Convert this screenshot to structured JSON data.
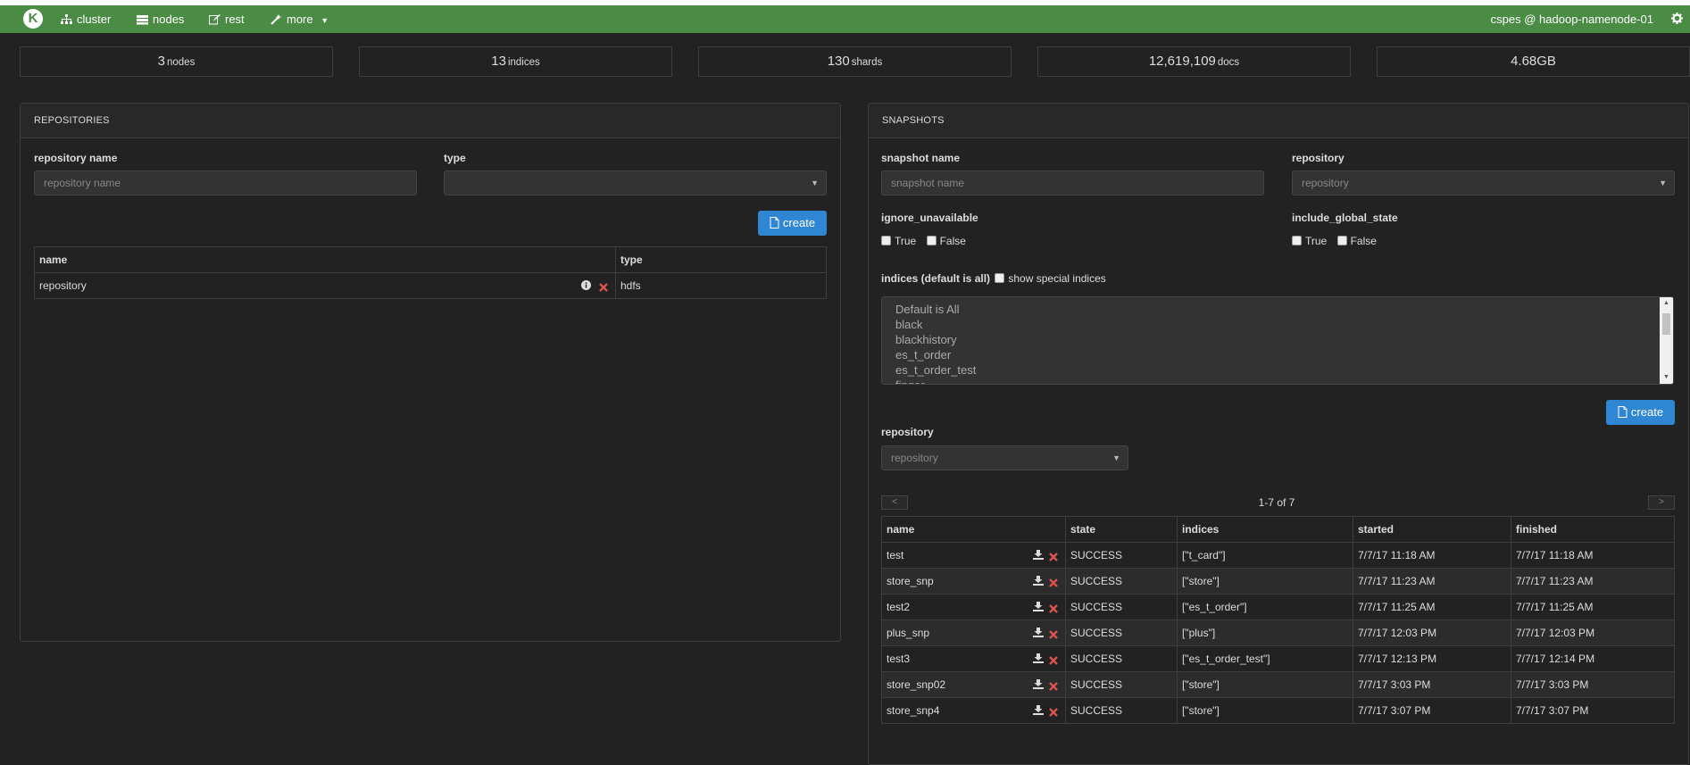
{
  "nav": {
    "logo": "K",
    "items": [
      {
        "label": "cluster",
        "icon": "sitemap-icon"
      },
      {
        "label": "nodes",
        "icon": "server-icon"
      },
      {
        "label": "rest",
        "icon": "edit-icon"
      },
      {
        "label": "more",
        "icon": "magic-icon"
      }
    ],
    "user": "cspes @ hadoop-namenode-01",
    "settings_icon": "gear-icon"
  },
  "stats": [
    {
      "value": "3",
      "label": "nodes"
    },
    {
      "value": "13",
      "label": "indices"
    },
    {
      "value": "130",
      "label": "shards"
    },
    {
      "value": "12,619,109",
      "label": "docs"
    },
    {
      "value": "4.68GB",
      "label": ""
    }
  ],
  "repositories": {
    "title": "REPOSITORIES",
    "name_label": "repository name",
    "name_placeholder": "repository name",
    "type_label": "type",
    "type_value": "",
    "create_label": "create",
    "columns": [
      "name",
      "type"
    ],
    "rows": [
      {
        "name": "repository",
        "type": "hdfs"
      }
    ]
  },
  "snapshots": {
    "title": "SNAPSHOTS",
    "name_label": "snapshot name",
    "name_placeholder": "snapshot name",
    "repo_label": "repository",
    "repo_placeholder": "repository",
    "ignore_label": "ignore_unavailable",
    "global_label": "include_global_state",
    "true_label": "True",
    "false_label": "False",
    "indices_label": "indices (default is all)",
    "special_label": "show special indices",
    "indices_options": [
      "Default is All",
      "black",
      "blackhistory",
      "es_t_order",
      "es_t_order_test",
      "finger"
    ],
    "create_label": "create",
    "filter_repo_label": "repository",
    "filter_repo_placeholder": "repository",
    "pagination": {
      "prev": "<",
      "summary": "1-7 of 7",
      "next": ">"
    },
    "columns": [
      "name",
      "state",
      "indices",
      "started",
      "finished"
    ],
    "rows": [
      {
        "name": "test",
        "state": "SUCCESS",
        "indices": "[\"t_card\"]",
        "started": "7/7/17 11:18 AM",
        "finished": "7/7/17 11:18 AM"
      },
      {
        "name": "store_snp",
        "state": "SUCCESS",
        "indices": "[\"store\"]",
        "started": "7/7/17 11:23 AM",
        "finished": "7/7/17 11:23 AM"
      },
      {
        "name": "test2",
        "state": "SUCCESS",
        "indices": "[\"es_t_order\"]",
        "started": "7/7/17 11:25 AM",
        "finished": "7/7/17 11:25 AM"
      },
      {
        "name": "plus_snp",
        "state": "SUCCESS",
        "indices": "[\"plus\"]",
        "started": "7/7/17 12:03 PM",
        "finished": "7/7/17 12:03 PM"
      },
      {
        "name": "test3",
        "state": "SUCCESS",
        "indices": "[\"es_t_order_test\"]",
        "started": "7/7/17 12:13 PM",
        "finished": "7/7/17 12:14 PM"
      },
      {
        "name": "store_snp02",
        "state": "SUCCESS",
        "indices": "[\"store\"]",
        "started": "7/7/17 3:03 PM",
        "finished": "7/7/17 3:03 PM"
      },
      {
        "name": "store_snp4",
        "state": "SUCCESS",
        "indices": "[\"store\"]",
        "started": "7/7/17 3:07 PM",
        "finished": "7/7/17 3:07 PM"
      }
    ]
  },
  "colors": {
    "navbar": "#4a8c44",
    "background": "#222222",
    "primary_button": "#2f86d3",
    "delete": "#d9534f"
  }
}
